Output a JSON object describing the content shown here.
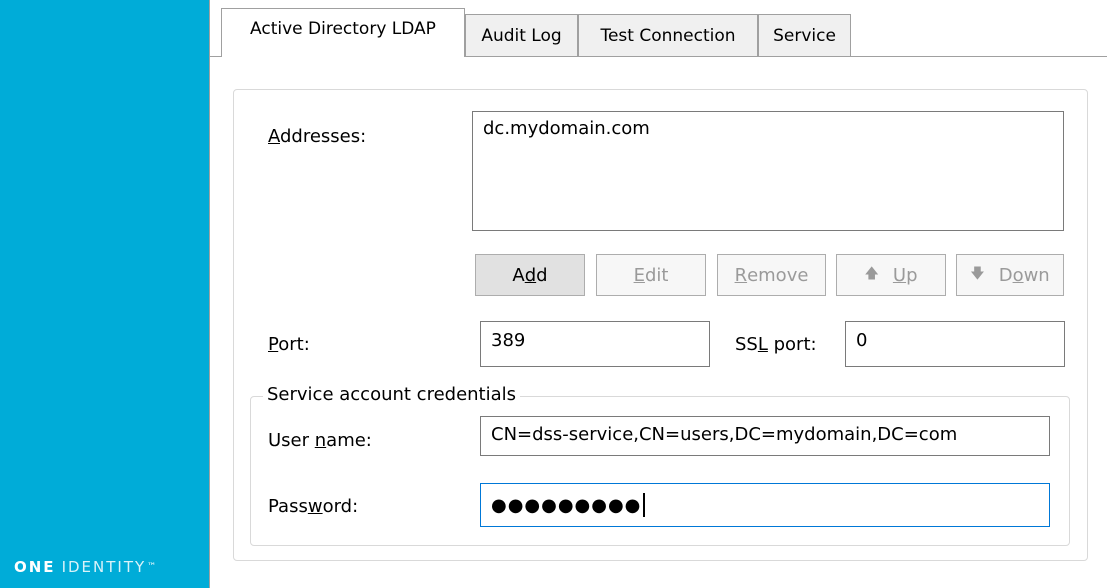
{
  "brand": {
    "name_one": "ONE",
    "name_rest": "IDENTITY",
    "trademark": "™"
  },
  "tabs": [
    {
      "label": "Active Directory LDAP",
      "active": true
    },
    {
      "label": "Audit Log",
      "active": false
    },
    {
      "label": "Test Connection",
      "active": false
    },
    {
      "label": "Service",
      "active": false
    }
  ],
  "addresses": {
    "label_pre": "",
    "label_mnemonic": "A",
    "label_post": "ddresses:",
    "items": [
      "dc.mydomain.com"
    ]
  },
  "buttons": {
    "add": {
      "pre": "A",
      "mnemonic": "d",
      "post": "d",
      "enabled": true
    },
    "edit": {
      "pre": "",
      "mnemonic": "E",
      "post": "dit",
      "enabled": false
    },
    "remove": {
      "pre": "",
      "mnemonic": "R",
      "post": "emove",
      "enabled": false
    },
    "up": {
      "pre": "",
      "mnemonic": "U",
      "post": "p",
      "enabled": false
    },
    "down": {
      "pre": "D",
      "mnemonic": "o",
      "post": "wn",
      "enabled": false
    }
  },
  "port": {
    "label_mnemonic": "P",
    "label_post": "ort:",
    "value": "389"
  },
  "ssl_port": {
    "label_pre": "SS",
    "label_mnemonic": "L",
    "label_post": " port:",
    "value": "0"
  },
  "credentials": {
    "legend": "Service account credentials",
    "username": {
      "label_pre": "User ",
      "label_mnemonic": "n",
      "label_post": "ame:",
      "value": "CN=dss-service,CN=users,DC=mydomain,DC=com"
    },
    "password": {
      "label_pre": "Pass",
      "label_mnemonic": "w",
      "label_post": "ord:",
      "masked_value": "●●●●●●●●●"
    }
  },
  "colors": {
    "sidebar": "#00acd8",
    "focus_border": "#0078d7"
  }
}
